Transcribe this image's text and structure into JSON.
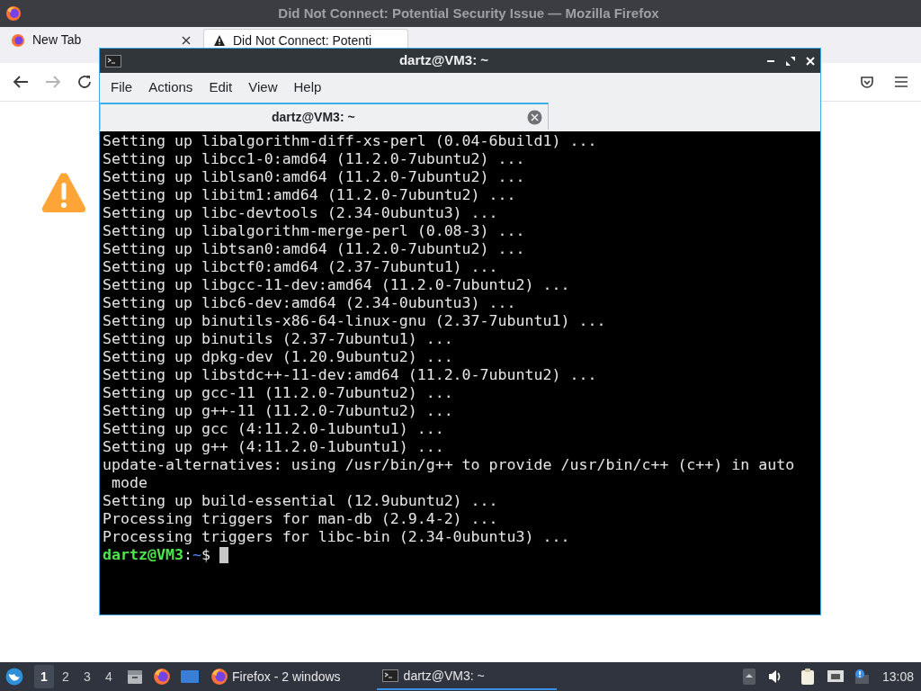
{
  "browser": {
    "title": "Did Not Connect: Potential Security Issue — Mozilla Firefox",
    "tabs": [
      {
        "label": "New Tab",
        "selected": false
      },
      {
        "label": "Did Not Connect: Potenti",
        "selected": true
      }
    ],
    "nav": {
      "back_disabled": false,
      "forward_disabled": true
    }
  },
  "terminal": {
    "title": "dartz@VM3: ~",
    "menu": [
      "File",
      "Actions",
      "Edit",
      "View",
      "Help"
    ],
    "tabs": [
      {
        "label": "dartz@VM3: ~",
        "selected": true
      }
    ],
    "lines": [
      "Setting up libalgorithm-diff-xs-perl (0.04-6build1) ...",
      "Setting up libcc1-0:amd64 (11.2.0-7ubuntu2) ...",
      "Setting up liblsan0:amd64 (11.2.0-7ubuntu2) ...",
      "Setting up libitm1:amd64 (11.2.0-7ubuntu2) ...",
      "Setting up libc-devtools (2.34-0ubuntu3) ...",
      "Setting up libalgorithm-merge-perl (0.08-3) ...",
      "Setting up libtsan0:amd64 (11.2.0-7ubuntu2) ...",
      "Setting up libctf0:amd64 (2.37-7ubuntu1) ...",
      "Setting up libgcc-11-dev:amd64 (11.2.0-7ubuntu2) ...",
      "Setting up libc6-dev:amd64 (2.34-0ubuntu3) ...",
      "Setting up binutils-x86-64-linux-gnu (2.37-7ubuntu1) ...",
      "Setting up binutils (2.37-7ubuntu1) ...",
      "Setting up dpkg-dev (1.20.9ubuntu2) ...",
      "Setting up libstdc++-11-dev:amd64 (11.2.0-7ubuntu2) ...",
      "Setting up gcc-11 (11.2.0-7ubuntu2) ...",
      "Setting up g++-11 (11.2.0-7ubuntu2) ...",
      "Setting up gcc (4:11.2.0-1ubuntu1) ...",
      "Setting up g++ (4:11.2.0-1ubuntu1) ...",
      "update-alternatives: using /usr/bin/g++ to provide /usr/bin/c++ (c++) in auto",
      " mode",
      "Setting up build-essential (12.9ubuntu2) ...",
      "Processing triggers for man-db (2.9.4-2) ...",
      "Processing triggers for libc-bin (2.34-0ubuntu3) ..."
    ],
    "prompt": {
      "user_host": "dartz@VM3",
      "sep": ":",
      "path": "~",
      "symbol": "$"
    }
  },
  "taskbar": {
    "workspaces": [
      {
        "label": "1",
        "selected": true
      },
      {
        "label": "2",
        "selected": false
      },
      {
        "label": "3",
        "selected": false
      },
      {
        "label": "4",
        "selected": false
      }
    ],
    "tasks": [
      {
        "kind": "firefox",
        "label": "Firefox - 2 windows",
        "selected": false
      },
      {
        "kind": "terminal",
        "label": "dartz@VM3: ~",
        "selected": true
      }
    ],
    "clock": "13:08"
  }
}
